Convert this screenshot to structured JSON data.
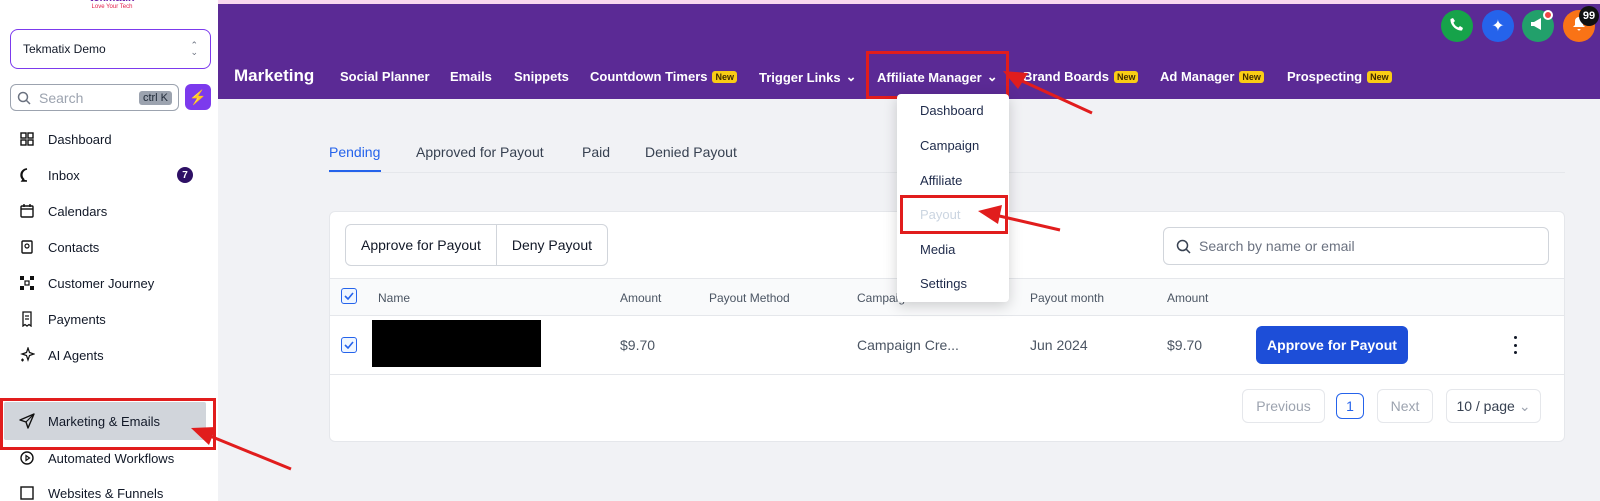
{
  "sidebar": {
    "logo_text": "tekmatix",
    "logo_tagline": "Love Your Tech",
    "account_name": "Tekmatix Demo",
    "search_placeholder": "Search",
    "search_shortcut": "ctrl K",
    "items": [
      {
        "label": "Dashboard",
        "icon": "dashboard-icon"
      },
      {
        "label": "Inbox",
        "icon": "chat-icon",
        "badge": "7"
      },
      {
        "label": "Calendars",
        "icon": "calendar-icon"
      },
      {
        "label": "Contacts",
        "icon": "contacts-icon"
      },
      {
        "label": "Customer Journey",
        "icon": "journey-icon"
      },
      {
        "label": "Payments",
        "icon": "receipt-icon"
      },
      {
        "label": "AI Agents",
        "icon": "sparkle-icon"
      },
      {
        "label": "Marketing & Emails",
        "icon": "send-icon",
        "active": true
      },
      {
        "label": "Automated Workflows",
        "icon": "workflow-icon"
      },
      {
        "label": "Websites & Funnels",
        "icon": "globe-icon"
      }
    ]
  },
  "header": {
    "title": "Marketing",
    "nav": [
      {
        "label": "Social Planner"
      },
      {
        "label": "Emails"
      },
      {
        "label": "Snippets"
      },
      {
        "label": "Countdown Timers",
        "badge": "New"
      },
      {
        "label": "Trigger Links",
        "dropdown": true
      },
      {
        "label": "Affiliate Manager",
        "dropdown": true,
        "open": true
      },
      {
        "label": "Brand Boards",
        "badge": "New"
      },
      {
        "label": "Ad Manager",
        "badge": "New"
      },
      {
        "label": "Prospecting",
        "badge": "New"
      }
    ],
    "notification_count": "99",
    "colors": {
      "bar": "#5b2a95",
      "new_badge": "#facc15"
    }
  },
  "dropdown": {
    "items": [
      {
        "label": "Dashboard"
      },
      {
        "label": "Campaign"
      },
      {
        "label": "Affiliate"
      },
      {
        "label": "Payout",
        "disabled": true
      },
      {
        "label": "Media"
      },
      {
        "label": "Settings"
      }
    ]
  },
  "tabs": [
    "Pending",
    "Approved for Payout",
    "Paid",
    "Denied Payout"
  ],
  "actions": {
    "approve": "Approve for Payout",
    "deny": "Deny Payout",
    "search_placeholder": "Search by name or email"
  },
  "table": {
    "columns": [
      "Name",
      "Amount",
      "Payout Method",
      "Campaign",
      "Payout month",
      "Amount"
    ],
    "rows": [
      {
        "name": "",
        "amount": "$9.70",
        "payout_method": "",
        "campaign": "Campaign Cre...",
        "payout_month": "Jun 2024",
        "amount2": "$9.70",
        "action": "Approve for Payout"
      }
    ]
  },
  "pagination": {
    "previous": "Previous",
    "current": "1",
    "next": "Next",
    "page_size": "10 / page"
  }
}
